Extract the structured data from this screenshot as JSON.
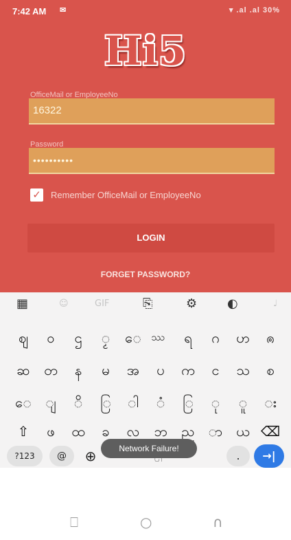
{
  "status_bar": {
    "time": "7:42 AM",
    "notification": "✉",
    "system_icons": "▾ .al .al 30%"
  },
  "app": {
    "logo": "Hi5",
    "login_field": {
      "label": "OfficeMail or EmployeeNo",
      "value": "16322"
    },
    "password_field": {
      "label": "Password",
      "value": "••••••••••"
    },
    "remember": {
      "checked": true,
      "label": "Remember OfficeMail or EmployeeNo"
    },
    "login_button": "LOGIN",
    "forget_link": "FORGET PASSWORD?"
  },
  "keyboard": {
    "toolbar": [
      "▦",
      "☺",
      "GIF",
      "⎘",
      "⚙",
      "◐",
      "♩"
    ],
    "rows": [
      [
        "ဈ",
        "ဝ",
        "ဌ",
        "ၟ",
        "ေ",
        "ဿ",
        "ရ",
        "ဂ",
        "ဟ",
        "ၐ"
      ],
      [
        "ဆ",
        "တ",
        "န",
        "မ",
        "အ",
        "ပ",
        "က",
        "င",
        "သ",
        "စ"
      ],
      [
        "ေ",
        "ျ",
        "ိ",
        "ြ",
        "ါ",
        "ံ",
        "ြ",
        "ု",
        "ူ",
        "း"
      ],
      [
        "⇧",
        "ဖ",
        "ထ",
        "ခ",
        "လ",
        "ဘ",
        "ည",
        "ာ",
        "ယ",
        "⌫"
      ]
    ],
    "bottom_row": {
      "mode": "?123",
      "at": "@",
      "globe": "⊕",
      "space": "မြန်မာ",
      "period": ".",
      "enter": "→|"
    }
  },
  "toast": "Network Failure!",
  "nav_bar": {
    "recents": "⎕",
    "home": "○",
    "back": "∩"
  }
}
